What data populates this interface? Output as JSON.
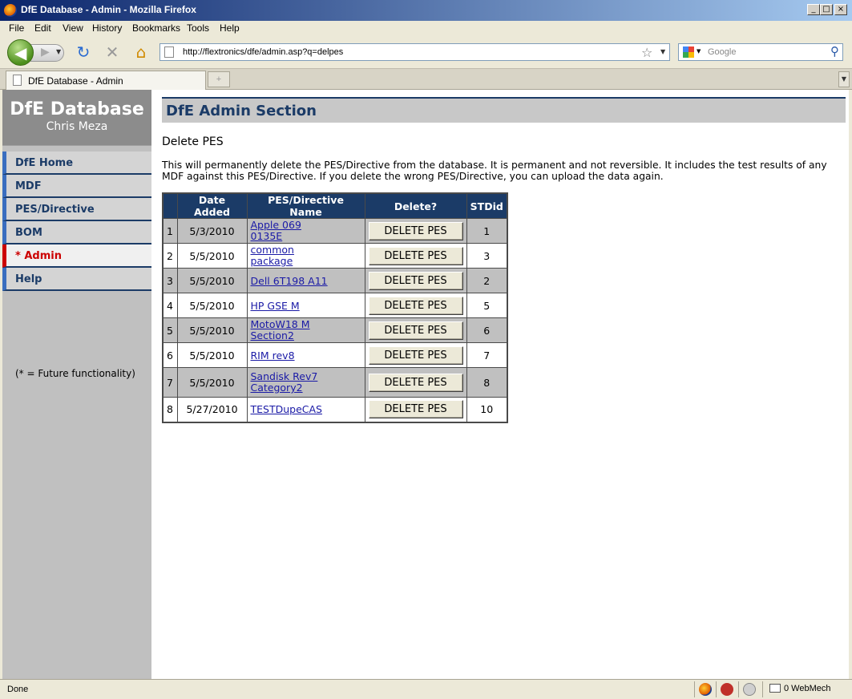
{
  "window": {
    "title": "DfE Database - Admin - Mozilla Firefox",
    "controls": [
      "_",
      "□",
      "×"
    ]
  },
  "menu": [
    "File",
    "Edit",
    "View",
    "History",
    "Bookmarks",
    "Tools",
    "Help"
  ],
  "nav": {
    "url": "http://flextronics/dfe/admin.asp?q=delpes",
    "search_placeholder": "Google"
  },
  "tabs": [
    {
      "label": "DfE Database - Admin",
      "active": true
    }
  ],
  "sidebar": {
    "brand": "DfE Database",
    "user": "Chris Meza",
    "items": [
      {
        "label": "DfE Home"
      },
      {
        "label": "MDF"
      },
      {
        "label": "PES/Directive"
      },
      {
        "label": "BOM"
      },
      {
        "label": "* Admin",
        "current": true
      },
      {
        "label": "Help"
      }
    ],
    "note": "(* = Future functionality)"
  },
  "main": {
    "section_title": "DfE Admin Section",
    "subheading": "Delete PES",
    "description": "This will permanently delete the PES/Directive from the database. It is permanent and not reversible. It includes the test results of any MDF against this PES/Directive. If you delete the wrong PES/Directive, you can upload the data again.",
    "table": {
      "headers": [
        "",
        "Date Added",
        "PES/Directive Name",
        "Delete?",
        "STDid"
      ],
      "button_label": "DELETE PES",
      "rows": [
        {
          "num": "1",
          "date": "5/3/2010",
          "name": "Apple 069 0135E",
          "stdid": "1"
        },
        {
          "num": "2",
          "date": "5/5/2010",
          "name": "common package",
          "stdid": "3"
        },
        {
          "num": "3",
          "date": "5/5/2010",
          "name": "Dell 6T198 A11",
          "stdid": "2"
        },
        {
          "num": "4",
          "date": "5/5/2010",
          "name": "HP GSE M",
          "stdid": "5"
        },
        {
          "num": "5",
          "date": "5/5/2010",
          "name": "MotoW18 M Section2",
          "stdid": "6"
        },
        {
          "num": "6",
          "date": "5/5/2010",
          "name": "RIM rev8",
          "stdid": "7"
        },
        {
          "num": "7",
          "date": "5/5/2010",
          "name": "Sandisk Rev7 Category2",
          "stdid": "8"
        },
        {
          "num": "8",
          "date": "5/27/2010",
          "name": "TESTDupeCAS",
          "stdid": "10"
        }
      ]
    }
  },
  "statusbar": {
    "status": "Done",
    "mail": "0 WebMech"
  },
  "colors": {
    "navy": "#1b3b67",
    "sidebar_bg": "#c0c0c0",
    "current_red": "#cc0000",
    "link": "#1a1aa6"
  }
}
